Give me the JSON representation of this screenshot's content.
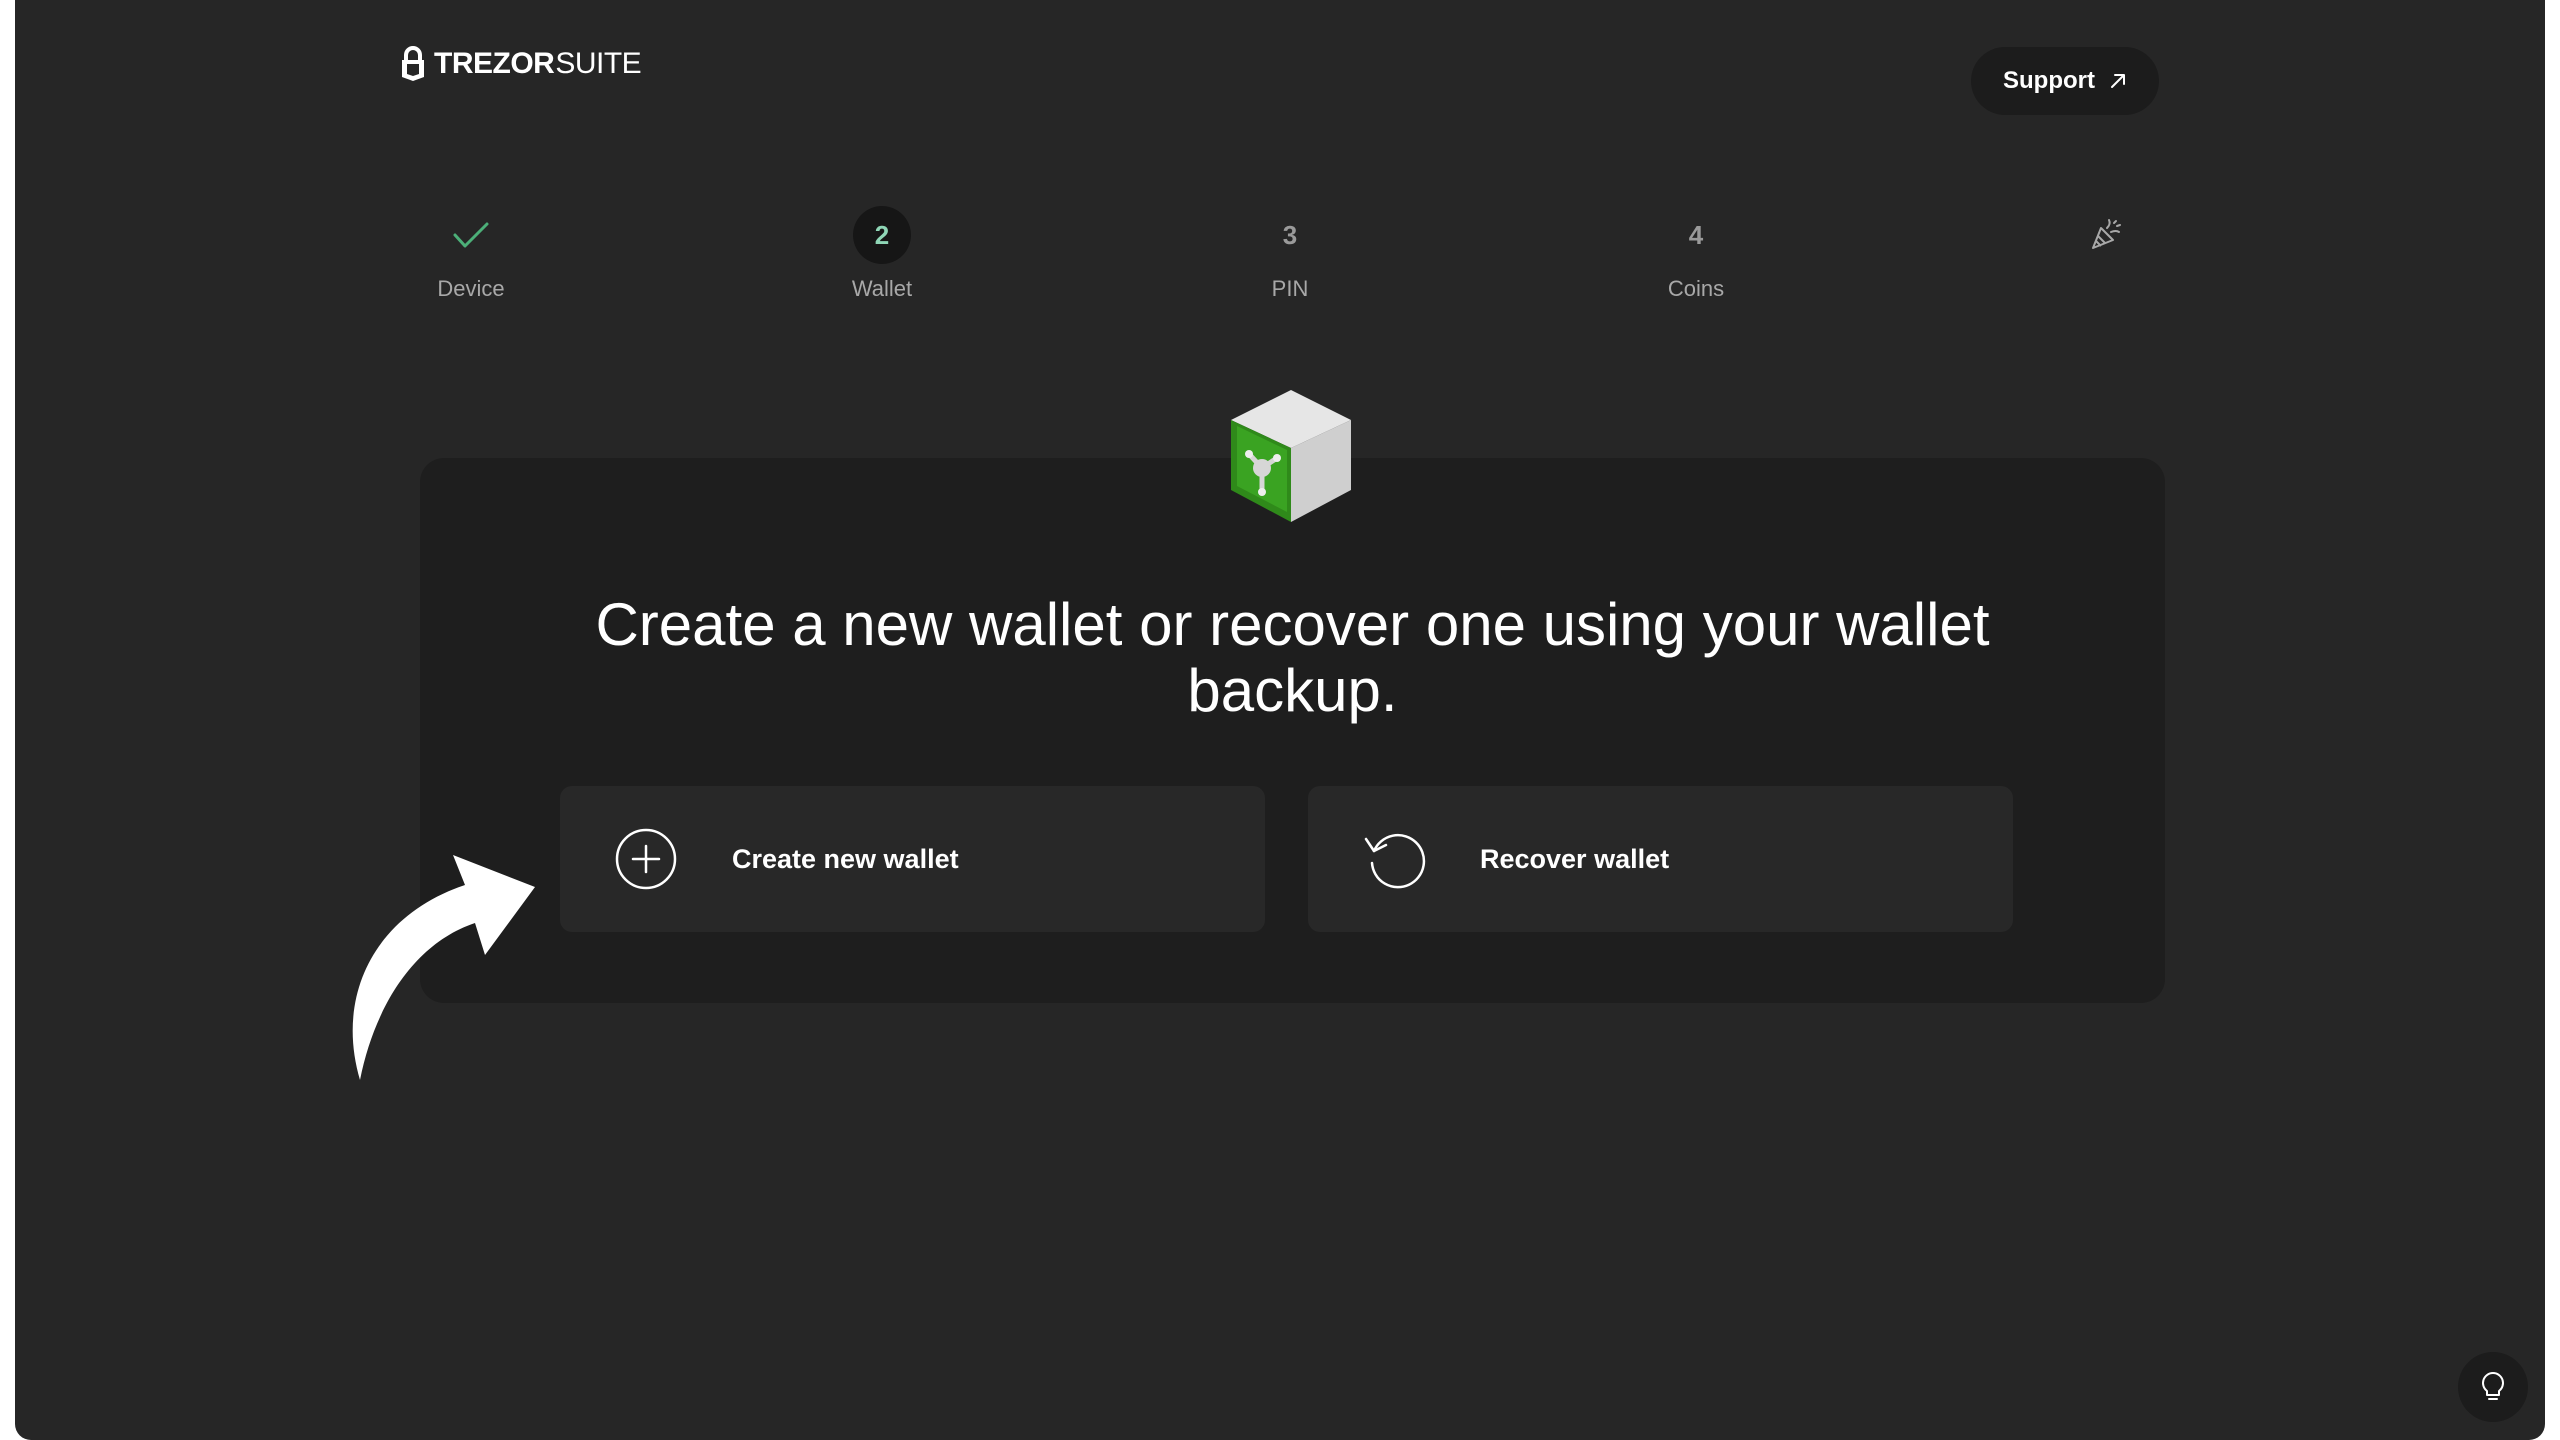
{
  "header": {
    "logo_brand": "TREZOR",
    "logo_suite": "SUITE",
    "support_label": "Support"
  },
  "steps": [
    {
      "marker": "",
      "label": "Device",
      "state": "done"
    },
    {
      "marker": "2",
      "label": "Wallet",
      "state": "active"
    },
    {
      "marker": "3",
      "label": "PIN",
      "state": "pending"
    },
    {
      "marker": "4",
      "label": "Coins",
      "state": "pending"
    },
    {
      "marker": "",
      "label": "",
      "state": "final"
    }
  ],
  "main": {
    "heading": "Create a new wallet or recover one using your wallet backup.",
    "create_label": "Create new wallet",
    "recover_label": "Recover wallet"
  },
  "colors": {
    "background": "#262626",
    "card": "#1e1e1e",
    "accent": "#8fd6b6",
    "check": "#4caf78"
  },
  "icons": {
    "support": "arrow-up-right-icon",
    "create": "plus-circle-icon",
    "recover": "restore-icon",
    "final_step": "party-popper-icon",
    "tip": "lightbulb-icon"
  }
}
